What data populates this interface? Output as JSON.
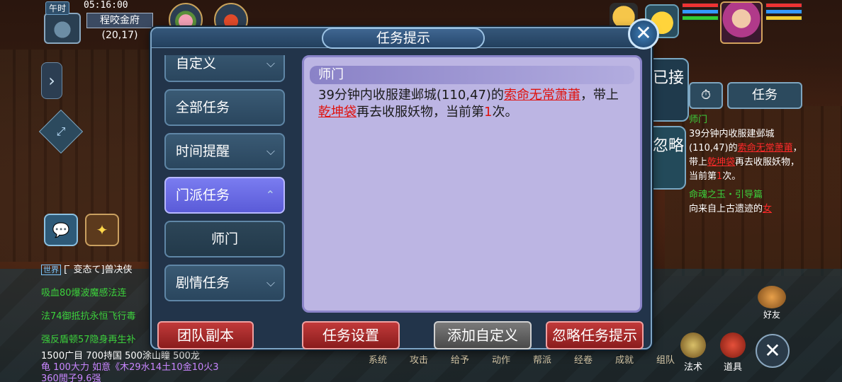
{
  "hud": {
    "time_badge": "午时",
    "clock": "05:16:00",
    "place": "程咬金府",
    "coord": "(20,17)"
  },
  "dialog": {
    "title": "任务提示",
    "categories": [
      {
        "label": "自定义",
        "chevron": "⌵"
      },
      {
        "label": "全部任务",
        "chevron": ""
      },
      {
        "label": "时间提醒",
        "chevron": "⌵"
      },
      {
        "label": "门派任务",
        "chevron": "⌃"
      },
      {
        "label": "师门",
        "chevron": ""
      },
      {
        "label": "剧情任务",
        "chevron": "⌵"
      }
    ],
    "content_title": "师门",
    "content": {
      "part1": "39分钟内收服建邺城(110,47)的",
      "target": "索命无常萧莆",
      "part2": "，带上",
      "item": "乾坤袋",
      "part3": "再去收服妖物，当前第",
      "count": "1",
      "part4": "次。"
    },
    "buttons": {
      "team": "团队副本",
      "settings": "任务设置",
      "add_custom": "添加自定义",
      "ignore": "忽略任务提示"
    }
  },
  "tracker": {
    "tab_accepted": "已接",
    "tab_ignored": "忽略",
    "clock_icon": "⏱",
    "task_label": "任务",
    "quest_title": "师门",
    "quest_p1": "39分钟内收服建邺城(110,47)的",
    "quest_target": "索命无常萧莆",
    "quest_p2": "，带上",
    "quest_item": "乾坤袋",
    "quest_p3": "再去收服妖物，当前第",
    "quest_count": "1",
    "quest_p4": "次。",
    "quest2_title": "命魂之玉・引导篇",
    "quest2_text": "向来自上古遗迹的",
    "quest2_tail": "女"
  },
  "chat": {
    "world_tag": "世界",
    "line1": "[  ̄ 变态て]兽决侠",
    "line2": "吸血80爆波魔感法连",
    "line3": "法74御抵抗永恒飞行毒",
    "line4": "强反盾顿57隐身再生补",
    "bottom1": "1500广目 700持国 500涂山瞳 500龙",
    "bottom2": "龟 100大力 如意《木29水14土10金10火3",
    "bottom3": "360閒子9.6强"
  },
  "bottom_bar": {
    "items": [
      "系统",
      "攻击",
      "给予",
      "动作",
      "帮派",
      "经卷",
      "成就",
      "组队"
    ],
    "skill": "法术",
    "bag": "道具",
    "friend": "好友"
  },
  "colors": {
    "accent": "#5a5bd8",
    "quest_red": "#e0120e",
    "quest_green": "#3cd13c"
  }
}
